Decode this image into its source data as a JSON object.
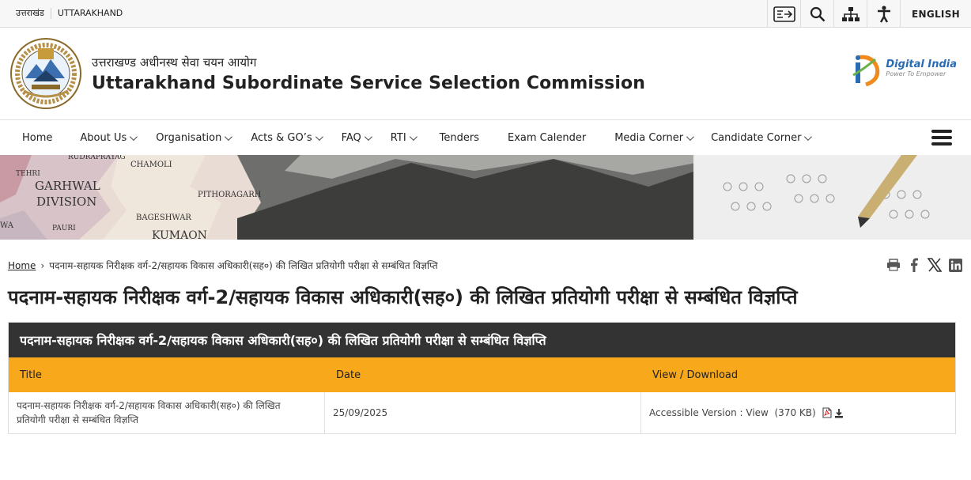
{
  "topbar": {
    "left_hi": "उत्तराखंड",
    "left_en": "UTTARAKHAND",
    "language": "ENGLISH",
    "icons": [
      "screen-reader-icon",
      "search-icon",
      "sitemap-icon",
      "accessibility-icon"
    ]
  },
  "header": {
    "title_hi": "उत्तराखण्ड अधीनस्थ सेवा चयन आयोग",
    "title_en": "Uttarakhand Subordinate Service Selection Commission",
    "digital_india": "Digital India",
    "digital_india_tagline": "Power To Empower"
  },
  "nav": {
    "items": [
      {
        "label": "Home",
        "dropdown": false
      },
      {
        "label": "About Us",
        "dropdown": true
      },
      {
        "label": "Organisation",
        "dropdown": true
      },
      {
        "label": "Acts & GO’s",
        "dropdown": true
      },
      {
        "label": "FAQ",
        "dropdown": true
      },
      {
        "label": "RTI",
        "dropdown": true
      },
      {
        "label": "Tenders",
        "dropdown": false
      },
      {
        "label": "Exam Calender",
        "dropdown": false
      },
      {
        "label": "Media Corner",
        "dropdown": true
      },
      {
        "label": "Candidate Corner",
        "dropdown": true
      }
    ]
  },
  "banner": {
    "map_labels": [
      "RUDRAPRAYAG",
      "CHAMOLI",
      "TEHRI",
      "GARHWAL",
      "DIVISION",
      "PITHORAGARH",
      "BAGESHWAR",
      "PAURI",
      "KUMAON",
      "WA"
    ]
  },
  "breadcrumb": {
    "home": "Home",
    "current": "पदनाम-सहायक निरीक्षक वर्ग-2/सहायक विकास अधिकारी(सह०) की लिखित प्रतियोगी परीक्षा से सम्बंधित विज्ञप्ति"
  },
  "page": {
    "title": "पदनाम-सहायक निरीक्षक वर्ग-2/सहायक विकास अधिकारी(सह०) की लिखित प्रतियोगी परीक्षा से सम्बंधित विज्ञप्ति"
  },
  "table": {
    "caption": "पदनाम-सहायक निरीक्षक वर्ग-2/सहायक विकास अधिकारी(सह०) की लिखित प्रतियोगी परीक्षा से सम्बंधित विज्ञप्ति",
    "columns": [
      "Title",
      "Date",
      "View / Download"
    ],
    "rows": [
      {
        "title": "पदनाम-सहायक निरीक्षक वर्ग-2/सहायक विकास अधिकारी(सह०) की लिखित प्रतियोगी परीक्षा से सम्बंधित विज्ञप्ति",
        "date": "25/09/2025",
        "accessible_label": "Accessible Version :",
        "view_label": "View",
        "size": "(370 KB)"
      }
    ]
  },
  "colors": {
    "accent": "#f7a81b",
    "table_head": "#333333"
  }
}
